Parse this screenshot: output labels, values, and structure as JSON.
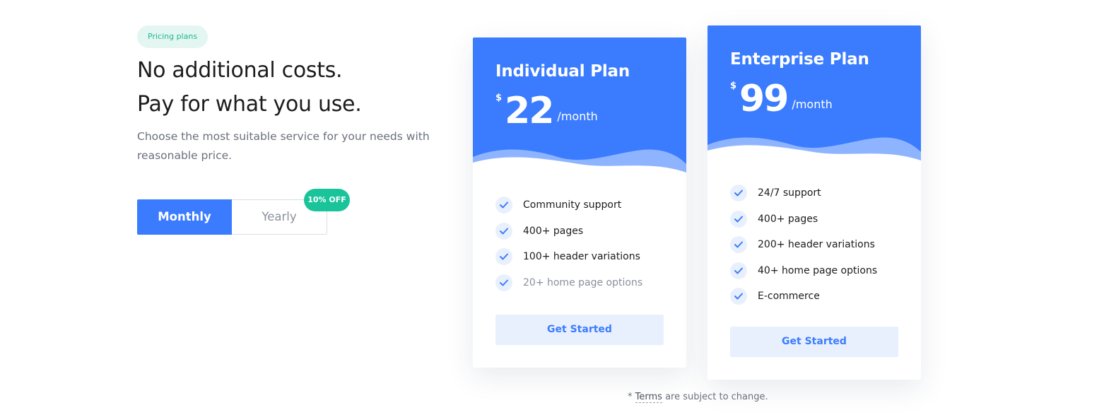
{
  "hero": {
    "badge": "Pricing plans",
    "headline_line1": "No additional costs.",
    "headline_line2": "Pay for what you use.",
    "subtext": "Choose the most suitable service for your needs with reasonable price."
  },
  "billing_toggle": {
    "monthly_label": "Monthly",
    "yearly_label": "Yearly",
    "selected": "Monthly",
    "discount_badge": "10% OFF"
  },
  "plans": [
    {
      "name": "Individual Plan",
      "currency": "$",
      "price": "22",
      "period": "/month",
      "features": [
        {
          "label": "Community support",
          "included": true
        },
        {
          "label": "400+ pages",
          "included": true
        },
        {
          "label": "100+ header variations",
          "included": true
        },
        {
          "label": "20+ home page options",
          "included": true
        }
      ],
      "cta": "Get Started"
    },
    {
      "name": "Enterprise Plan",
      "currency": "$",
      "price": "99",
      "period": "/month",
      "features": [
        {
          "label": "24/7 support",
          "included": true
        },
        {
          "label": "400+ pages",
          "included": true
        },
        {
          "label": "200+ header variations",
          "included": true
        },
        {
          "label": "40+ home page options",
          "included": true
        },
        {
          "label": "E-commerce",
          "included": true
        }
      ],
      "cta": "Get Started"
    }
  ],
  "footnote": {
    "prefix": "* ",
    "link": "Terms",
    "suffix": " are subject to change."
  },
  "colors": {
    "primary": "#3b7cff",
    "badge_green": "#19c49a",
    "badge_bg": "#e3f6f1",
    "muted_text": "#6b6f7c"
  },
  "icons": {
    "feature_check": "check-icon"
  }
}
